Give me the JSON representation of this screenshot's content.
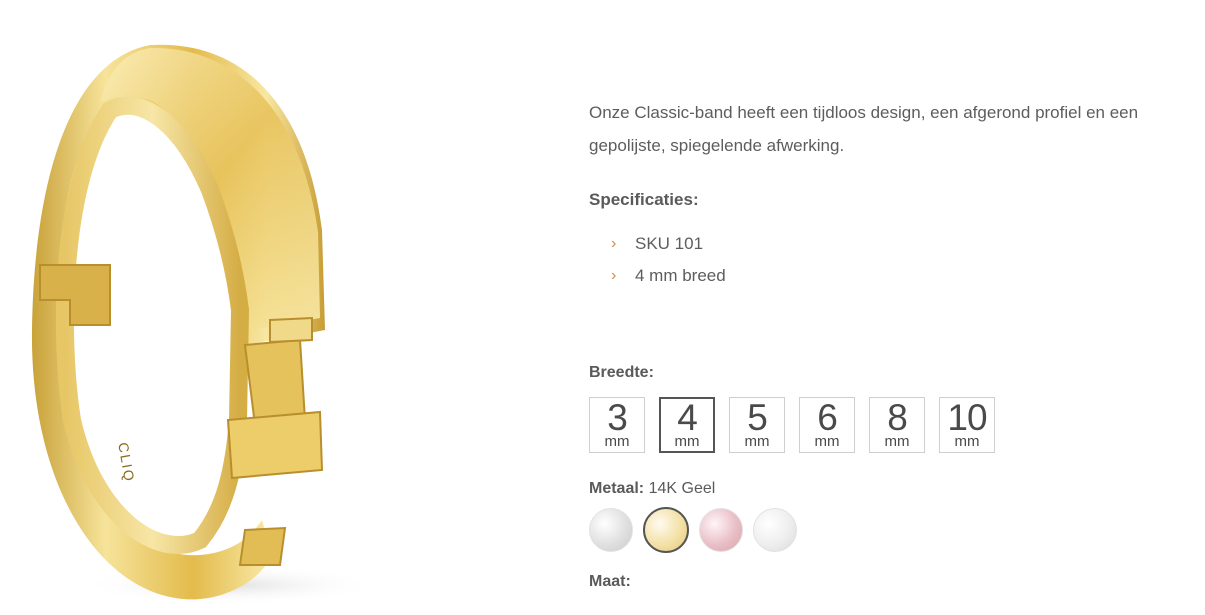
{
  "product": {
    "image_alt": "ring-image",
    "engraving": "CLIQ"
  },
  "description": "Onze Classic-band heeft een tijdloos design, een afgerond profiel en een gepolijste, spiegelende afwerking.",
  "specs": {
    "title": "Specificaties:",
    "items": [
      {
        "icon": "chevron-right-icon",
        "label": "SKU 101"
      },
      {
        "icon": "chevron-right-icon",
        "label": "4 mm breed"
      }
    ]
  },
  "width": {
    "label": "Breedte:",
    "unit": "mm",
    "options": [
      "3",
      "4",
      "5",
      "6",
      "8",
      "10"
    ],
    "selected": "4"
  },
  "metal": {
    "label": "Metaal:",
    "selected_name": "14K Geel",
    "swatches": [
      {
        "name": "white-gold",
        "color": "#e8e8e8"
      },
      {
        "name": "yellow-gold",
        "color": "#f3e1a6"
      },
      {
        "name": "rose-gold",
        "color": "#e9bfc6"
      },
      {
        "name": "platinum",
        "color": "#eeeeee"
      }
    ],
    "selected_index": 1
  },
  "size": {
    "label": "Maat:"
  },
  "colors": {
    "accent": "#d48a4b",
    "gold": "#e6c158"
  }
}
